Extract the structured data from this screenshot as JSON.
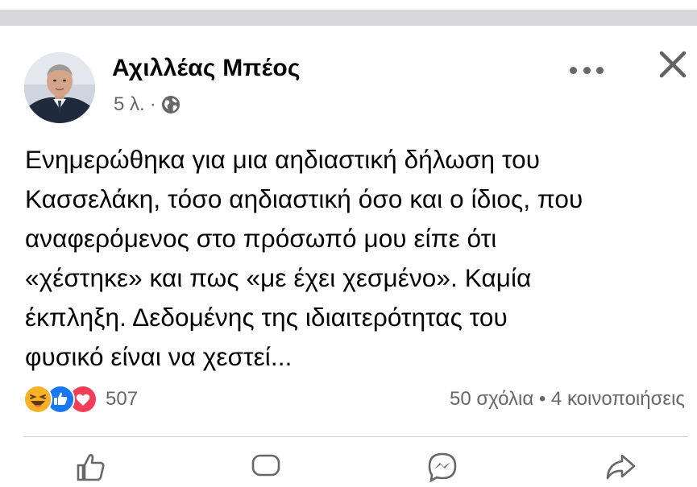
{
  "post": {
    "author": "Αχιλλέας Μπέος",
    "time": "5 λ.",
    "separator": "·",
    "text_lines": [
      "Ενημερώθηκα για μια αηδιαστική δήλωση του",
      "Κασσελάκη, τόσο αηδιαστική όσο και ο ίδιος, που",
      "αναφερόμενος στο πρόσωπό μου είπε ότι",
      "«χέστηκε» και πως «με έχει χεσμένο». Καμία",
      "έκπληξη. Δεδομένης της ιδιαιτερότητας του",
      "φυσικό είναι να χεστεί..."
    ],
    "reactions": {
      "types": [
        "haha",
        "like",
        "love"
      ],
      "count": "507"
    },
    "stats": "50 σχόλια • 4 κοινοποιήσεις"
  },
  "colors": {
    "like_blue": "#1877f2",
    "love_red": "#f33e58",
    "haha_yellow": "#f7b125",
    "secondary_text": "#65676b",
    "divider": "#ced0d4"
  }
}
